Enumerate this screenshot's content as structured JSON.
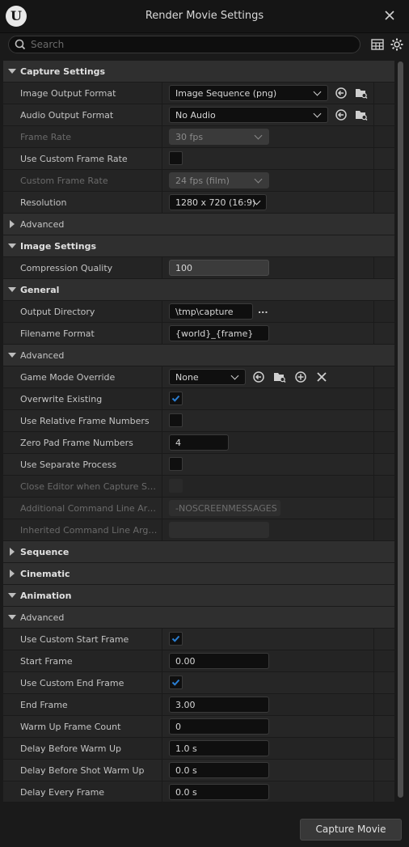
{
  "window": {
    "title": "Render Movie Settings",
    "logo_text": "U"
  },
  "search": {
    "placeholder": "Search",
    "value": ""
  },
  "capture_settings": {
    "header": "Capture Settings",
    "image_output_format": {
      "label": "Image Output Format",
      "value": "Image Sequence (png)"
    },
    "audio_output_format": {
      "label": "Audio Output Format",
      "value": "No Audio"
    },
    "frame_rate": {
      "label": "Frame Rate",
      "value": "30 fps"
    },
    "use_custom_frame_rate": {
      "label": "Use Custom Frame Rate",
      "checked": false
    },
    "custom_frame_rate": {
      "label": "Custom Frame Rate",
      "value": "24 fps (film)"
    },
    "resolution": {
      "label": "Resolution",
      "value": "1280 x 720 (16:9)"
    },
    "advanced": {
      "label": "Advanced"
    }
  },
  "image_settings": {
    "header": "Image Settings",
    "compression_quality": {
      "label": "Compression Quality",
      "value": "100"
    }
  },
  "general": {
    "header": "General",
    "output_directory": {
      "label": "Output Directory",
      "value": "\\tmp\\capture",
      "browse": "..."
    },
    "filename_format": {
      "label": "Filename Format",
      "value": "{world}_{frame}"
    }
  },
  "advanced": {
    "header": "Advanced",
    "game_mode_override": {
      "label": "Game Mode Override",
      "value": "None"
    },
    "overwrite_existing": {
      "label": "Overwrite Existing",
      "checked": true
    },
    "use_relative_frame_numbers": {
      "label": "Use Relative Frame Numbers",
      "checked": false
    },
    "zero_pad_frame_numbers": {
      "label": "Zero Pad Frame Numbers",
      "value": "4"
    },
    "use_separate_process": {
      "label": "Use Separate Process",
      "checked": false
    },
    "close_editor": {
      "label": "Close Editor when Capture Starts",
      "checked": false
    },
    "additional_cmd": {
      "label": "Additional Command Line Argum...",
      "value": "-NOSCREENMESSAGES"
    },
    "inherited_cmd": {
      "label": "Inherited Command Line Argum...",
      "value": ""
    }
  },
  "sequence": {
    "header": "Sequence"
  },
  "cinematic": {
    "header": "Cinematic"
  },
  "animation": {
    "header": "Animation",
    "advanced": "Advanced",
    "use_custom_start_frame": {
      "label": "Use Custom Start Frame",
      "checked": true
    },
    "start_frame": {
      "label": "Start Frame",
      "value": "0.00"
    },
    "use_custom_end_frame": {
      "label": "Use Custom End Frame",
      "checked": true
    },
    "end_frame": {
      "label": "End Frame",
      "value": "3.00"
    },
    "warm_up_frame_count": {
      "label": "Warm Up Frame Count",
      "value": "0"
    },
    "delay_before_warm_up": {
      "label": "Delay Before Warm Up",
      "value": "1.0 s"
    },
    "delay_before_shot_warm_up": {
      "label": "Delay Before Shot Warm Up",
      "value": "0.0 s"
    },
    "delay_every_frame": {
      "label": "Delay Every Frame",
      "value": "0.0 s"
    }
  },
  "footer": {
    "capture_button": "Capture Movie"
  },
  "colors": {
    "accent": "#2a7fd4",
    "background": "#242424",
    "category": "#2f2f2f"
  },
  "icons": [
    "close-icon",
    "search-icon",
    "table-icon",
    "gear-icon",
    "reset-arrow-icon",
    "browse-folder-icon",
    "add-icon",
    "clear-icon",
    "checkmark-icon"
  ]
}
